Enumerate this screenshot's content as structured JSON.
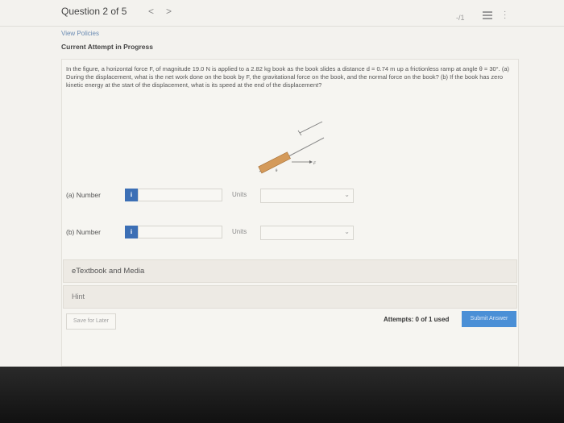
{
  "header": {
    "question_counter": "Question 2 of 5",
    "prev_icon": "chevron-left-icon",
    "prev_glyph": "<",
    "next_icon": "chevron-right-icon",
    "next_glyph": ">",
    "score": "-/1",
    "list_icon": "list-icon",
    "more_icon": "more-vertical-icon"
  },
  "links": {
    "view_policies": "View Policies"
  },
  "status": {
    "attempt_status": "Current Attempt in Progress"
  },
  "question": {
    "text": "In the figure, a horizontal force F, of magnitude 19.0 N is applied to a 2.82 kg book as the book slides a distance d = 0.74 m up a frictionless ramp at angle θ = 30°. (a) During the displacement, what is the net work done on the book by F, the gravitational force on the book, and the normal force on the book? (b) If the book has zero kinetic energy at the start of the displacement, what is its speed at the end of the displacement?",
    "figure_labels": {
      "force": "F",
      "angle": "θ"
    }
  },
  "answers": [
    {
      "label": "(a)   Number",
      "info_glyph": "i",
      "value": "",
      "units_label": "Units",
      "units_value": ""
    },
    {
      "label": "(b)   Number",
      "info_glyph": "i",
      "value": "",
      "units_label": "Units",
      "units_value": ""
    }
  ],
  "resources": {
    "etextbook": "eTextbook and Media",
    "hint": "Hint"
  },
  "footer": {
    "save_later": "Save for Later",
    "attempts": "Attempts: 0 of 1 used",
    "submit": "Submit Answer"
  },
  "colors": {
    "accent_blue": "#3c6fb5",
    "submit_blue": "#4a8fd6",
    "link_blue": "#6a8bb3",
    "book": "#d49a5a",
    "background": "#f3f2ee"
  }
}
